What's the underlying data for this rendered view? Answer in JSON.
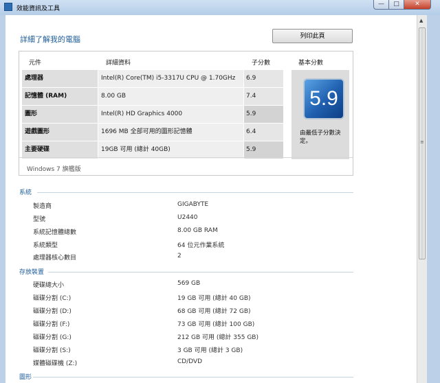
{
  "window": {
    "title": "效能資訊及工具",
    "minimize": "—",
    "maximize": "□",
    "close": "✕"
  },
  "header": {
    "title": "詳細了解我的電腦",
    "print_button": "列印此頁"
  },
  "score_table": {
    "headers": {
      "component": "元件",
      "details": "詳細資料",
      "subscore": "子分數",
      "base": "基本分數"
    },
    "rows": [
      {
        "component": "處理器",
        "details": "Intel(R) Core(TM) i5-3317U CPU @ 1.70GHz",
        "subscore": "6.9"
      },
      {
        "component": "記憶體 (RAM)",
        "details": "8.00 GB",
        "subscore": "7.4"
      },
      {
        "component": "圖形",
        "details": "Intel(R) HD Graphics 4000",
        "subscore": "5.9"
      },
      {
        "component": "遊戲圖形",
        "details": "1696 MB 全部可用的圖形記憶體",
        "subscore": "6.4"
      },
      {
        "component": "主要硬碟",
        "details": "19GB 可用 (總計 40GB)",
        "subscore": "5.9"
      }
    ],
    "base_score": "5.9",
    "base_note": "由最低子分數決定。",
    "edition": "Windows 7 旗艦版"
  },
  "system": {
    "heading": "系統",
    "items": [
      {
        "label": "製造商",
        "value": "GIGABYTE"
      },
      {
        "label": "型號",
        "value": "U2440"
      },
      {
        "label": "系統記憶體總數",
        "value": "8.00 GB RAM"
      },
      {
        "label": "系統類型",
        "value": "64 位元作業系統"
      },
      {
        "label": "處理器核心數目",
        "value": "2"
      }
    ]
  },
  "storage": {
    "heading": "存放裝置",
    "items": [
      {
        "label": "硬碟總大小",
        "value": "569 GB"
      },
      {
        "label": "磁碟分割 (C:)",
        "value": "19 GB 可用 (總計 40 GB)"
      },
      {
        "label": "磁碟分割 (D:)",
        "value": "68 GB 可用 (總計 72 GB)"
      },
      {
        "label": "磁碟分割 (F:)",
        "value": "73 GB 可用 (總計 100 GB)"
      },
      {
        "label": "磁碟分割 (G:)",
        "value": "212 GB 可用 (總計 355 GB)"
      },
      {
        "label": "磁碟分割 (S:)",
        "value": "3 GB 可用 (總計 3 GB)"
      },
      {
        "label": "媒體磁碟機 (Z:)",
        "value": "CD/DVD"
      }
    ]
  },
  "graphics": {
    "heading": "圖形"
  }
}
